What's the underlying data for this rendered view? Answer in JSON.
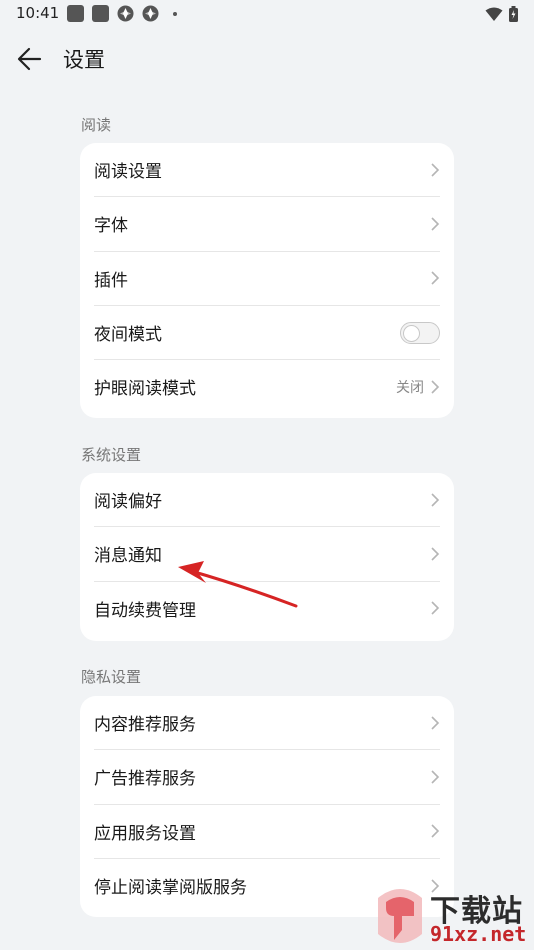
{
  "status_bar": {
    "time": "10:41"
  },
  "header": {
    "title": "设置"
  },
  "sections": [
    {
      "title": "阅读",
      "items": [
        {
          "label": "阅读设置"
        },
        {
          "label": "字体"
        },
        {
          "label": "插件"
        },
        {
          "label": "夜间模式",
          "toggle": false
        },
        {
          "label": "护眼阅读模式",
          "value": "关闭"
        }
      ]
    },
    {
      "title": "系统设置",
      "items": [
        {
          "label": "阅读偏好"
        },
        {
          "label": "消息通知"
        },
        {
          "label": "自动续费管理"
        }
      ]
    },
    {
      "title": "隐私设置",
      "items": [
        {
          "label": "内容推荐服务"
        },
        {
          "label": "广告推荐服务"
        },
        {
          "label": "应用服务设置"
        },
        {
          "label": "停止阅读掌阅版服务"
        }
      ]
    }
  ],
  "watermark": {
    "top_text": "下载站",
    "bottom_text": "91xz.net"
  },
  "colors": {
    "background": "#f1f3f5",
    "card": "#ffffff",
    "arrow": "#d62424",
    "watermark_red": "#c4272b"
  }
}
